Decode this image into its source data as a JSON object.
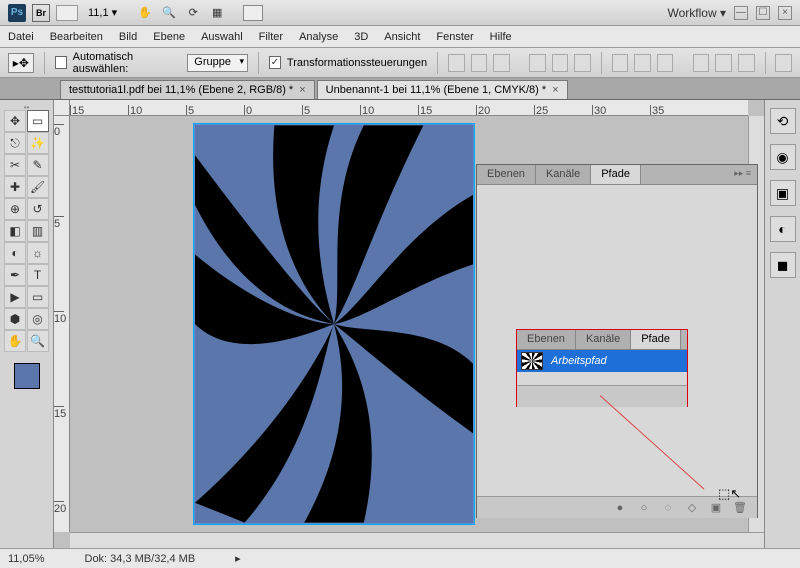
{
  "topbar": {
    "ps_label": "Ps",
    "br_label": "Br",
    "zoom": "11,1",
    "workflow": "Workflow ▾"
  },
  "menu": {
    "items": [
      "Datei",
      "Bearbeiten",
      "Bild",
      "Ebene",
      "Auswahl",
      "Filter",
      "Analyse",
      "3D",
      "Ansicht",
      "Fenster",
      "Hilfe"
    ]
  },
  "options": {
    "auto_select": "Automatisch auswählen:",
    "group": "Gruppe",
    "transform": "Transformationssteuerungen"
  },
  "tabs": [
    {
      "label": "testtutoria1l.pdf bei 11,1% (Ebene 2, RGB/8) *",
      "active": false
    },
    {
      "label": "Unbenannt-1 bei 11,1% (Ebene 1, CMYK/8) *",
      "active": true
    }
  ],
  "ruler_h": [
    "15",
    "10",
    "5",
    "0",
    "5",
    "10",
    "15",
    "20",
    "25",
    "30",
    "35"
  ],
  "ruler_v": [
    "0",
    "5",
    "10",
    "15",
    "20"
  ],
  "panel_main": {
    "tabs": [
      "Ebenen",
      "Kanäle",
      "Pfade"
    ],
    "active": 2
  },
  "panel_inner": {
    "tabs": [
      "Ebenen",
      "Kanäle",
      "Pfade"
    ],
    "active": 2,
    "path_item": "Arbeitspfad"
  },
  "status": {
    "zoom": "11,05%",
    "doc": "Dok: 34,3 MB/32,4 MB"
  },
  "colors": {
    "accent": "#5a76aa",
    "selection": "#1e6fd8"
  }
}
